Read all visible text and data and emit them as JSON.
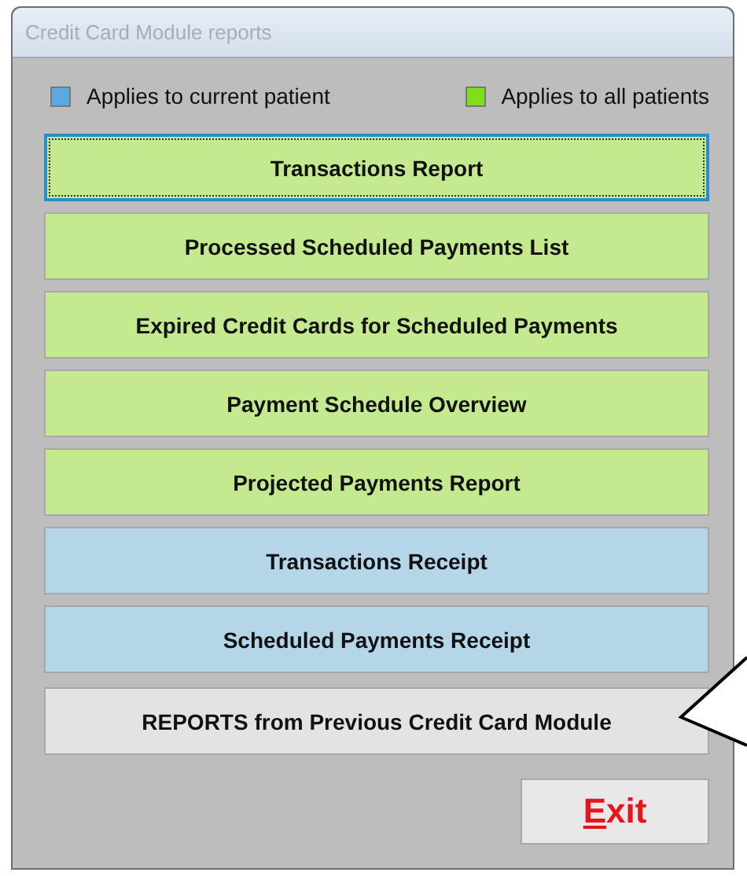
{
  "window": {
    "title": "Credit Card Module reports"
  },
  "legend": [
    {
      "label": "Applies to current patient",
      "color": "#5aa9e0"
    },
    {
      "label": "Applies to all patients",
      "color": "#7ee01a"
    }
  ],
  "buttons": [
    {
      "label": "Transactions Report",
      "kind": "all",
      "focused": true
    },
    {
      "label": "Processed Scheduled Payments List",
      "kind": "all",
      "focused": false
    },
    {
      "label": "Expired Credit Cards for Scheduled Payments",
      "kind": "all",
      "focused": false
    },
    {
      "label": "Payment Schedule Overview",
      "kind": "all",
      "focused": false
    },
    {
      "label": "Projected Payments Report",
      "kind": "all",
      "focused": false
    },
    {
      "label": "Transactions Receipt",
      "kind": "current",
      "focused": false
    },
    {
      "label": "Scheduled Payments Receipt",
      "kind": "current",
      "focused": false
    },
    {
      "label": "REPORTS from Previous Credit Card Module",
      "kind": "other",
      "focused": false
    }
  ],
  "exit_button": {
    "label": "Exit",
    "first_letter_underlined": true
  }
}
